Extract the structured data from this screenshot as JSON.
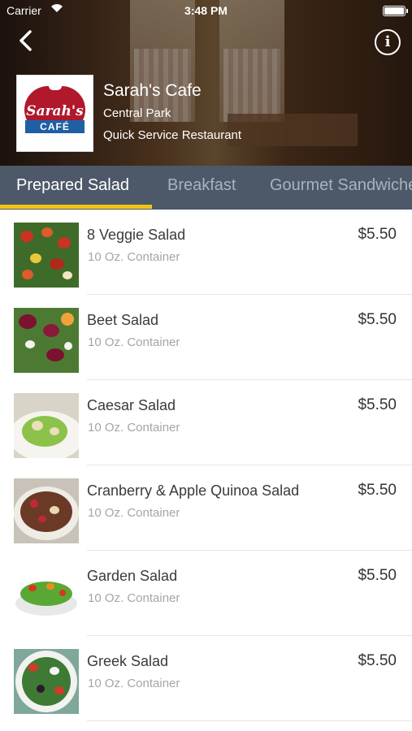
{
  "status_bar": {
    "carrier": "Carrier",
    "time": "3:48 PM"
  },
  "header": {
    "name": "Sarah's Cafe",
    "location": "Central Park",
    "type": "Quick Service Restaurant",
    "logo_text": "Sarah's",
    "logo_ribbon": "CAFÉ"
  },
  "tabs": [
    "Prepared Salad",
    "Breakfast",
    "Gourmet Sandwiches"
  ],
  "active_tab": "Prepared Salad",
  "colors": {
    "tab_bar": "#4d5868",
    "tab_indicator": "#f3c410",
    "logo_red": "#b1182c",
    "logo_blue": "#1f5fa3"
  },
  "items": [
    {
      "name": "8 Veggie Salad",
      "size": "10 Oz. Container",
      "price": "$5.50"
    },
    {
      "name": "Beet Salad",
      "size": "10 Oz. Container",
      "price": "$5.50"
    },
    {
      "name": "Caesar Salad",
      "size": "10 Oz. Container",
      "price": "$5.50"
    },
    {
      "name": "Cranberry & Apple Quinoa Salad",
      "size": "10 Oz. Container",
      "price": "$5.50"
    },
    {
      "name": "Garden Salad",
      "size": "10 Oz. Container",
      "price": "$5.50"
    },
    {
      "name": "Greek Salad",
      "size": "10 Oz. Container",
      "price": "$5.50"
    }
  ]
}
